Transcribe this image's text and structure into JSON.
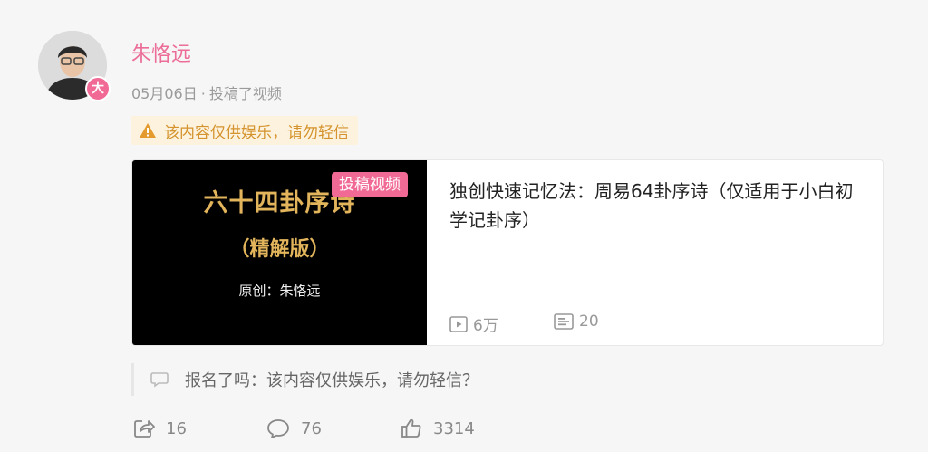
{
  "author": {
    "name": "朱恪远",
    "badge": "大"
  },
  "meta": {
    "date": "05月06日",
    "separator": "·",
    "action": "投稿了视频"
  },
  "warning": {
    "icon": "warning-icon",
    "text": "该内容仅供娱乐，请勿轻信"
  },
  "video_card": {
    "thumbnail": {
      "title": "六十四卦序诗",
      "subtitle": "（精解版）",
      "author": "原创：朱恪远"
    },
    "tag": "投稿视频",
    "title": "独创快速记忆法：周易64卦序诗（仅适用于小白初学记卦序）",
    "views": "6万",
    "comments": "20"
  },
  "quote": {
    "icon": "speech-bubble-icon",
    "text": "报名了吗：该内容仅供娱乐，请勿轻信？"
  },
  "actions": {
    "share": {
      "icon": "share-icon",
      "count": "16"
    },
    "comment": {
      "icon": "comment-icon",
      "count": "76"
    },
    "like": {
      "icon": "thumbs-up-icon",
      "count": "3314"
    }
  },
  "colors": {
    "accent": "#f06a95",
    "username": "#ec6d98",
    "warning_bg": "#fdf2dd",
    "warning_text": "#d4932d",
    "thumb_text": "#e2b45b"
  }
}
